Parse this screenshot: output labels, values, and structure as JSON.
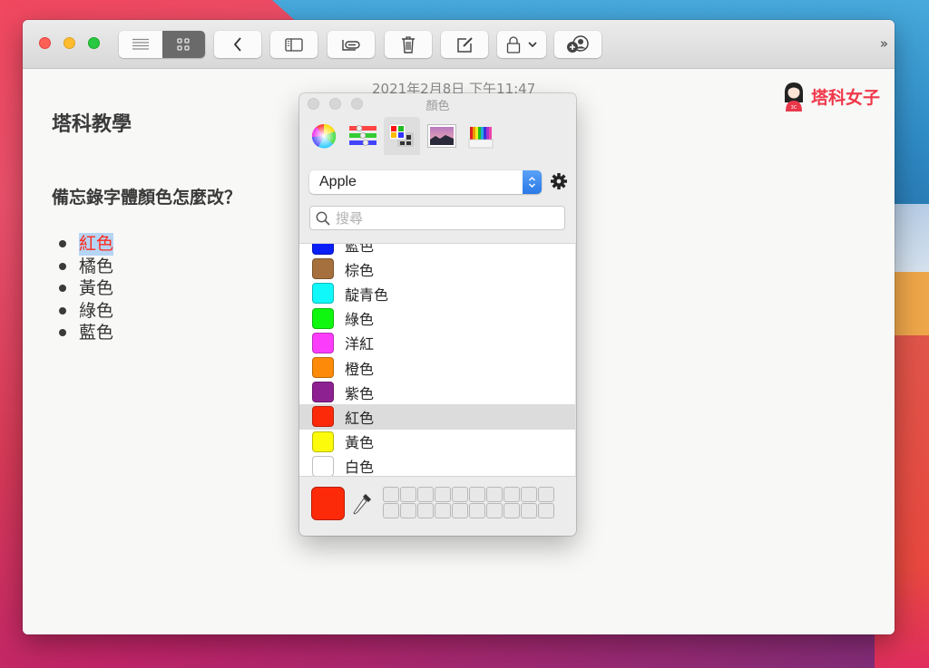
{
  "window": {
    "toolbar": {
      "buttons": [
        {
          "name": "list-view",
          "icon": "list-icon"
        },
        {
          "name": "gallery-view",
          "icon": "grid-icon",
          "active": true
        },
        {
          "name": "back",
          "icon": "chevron-left-icon"
        },
        {
          "name": "sidebar",
          "icon": "sidebar-icon"
        },
        {
          "name": "attachments",
          "icon": "paperclip-icon"
        },
        {
          "name": "delete",
          "icon": "trash-icon"
        },
        {
          "name": "compose",
          "icon": "compose-icon"
        },
        {
          "name": "lock",
          "icon": "lock-icon"
        },
        {
          "name": "add-people",
          "icon": "add-person-icon"
        }
      ],
      "more_label": "»"
    },
    "note": {
      "date": "2021年2月8日 下午11:47",
      "title": "塔科教學",
      "subtitle": "備忘錄字體顏色怎麼改？",
      "items": [
        {
          "text": "紅色",
          "selected": true,
          "color": "#ff2a1a"
        },
        {
          "text": "橘色"
        },
        {
          "text": "黃色"
        },
        {
          "text": "綠色"
        },
        {
          "text": "藍色"
        }
      ]
    },
    "brand": {
      "name": "塔科女子",
      "badge": "3C"
    }
  },
  "color_panel": {
    "title": "顏色",
    "modes": [
      {
        "name": "color-wheel",
        "icon": "color-wheel-icon"
      },
      {
        "name": "color-sliders",
        "icon": "sliders-icon"
      },
      {
        "name": "color-palettes",
        "icon": "palette-icon",
        "active": true
      },
      {
        "name": "image-palettes",
        "icon": "image-icon"
      },
      {
        "name": "pencils",
        "icon": "pencils-icon"
      }
    ],
    "palette_select": {
      "value": "Apple"
    },
    "search": {
      "placeholder": "搜尋"
    },
    "colors": [
      {
        "label": "藍色",
        "hex": "#0a1ef8"
      },
      {
        "label": "棕色",
        "hex": "#a5703d"
      },
      {
        "label": "靛青色",
        "hex": "#11f8fb"
      },
      {
        "label": "綠色",
        "hex": "#10f70f"
      },
      {
        "label": "洋紅",
        "hex": "#fb3dfb"
      },
      {
        "label": "橙色",
        "hex": "#fd8a08"
      },
      {
        "label": "紫色",
        "hex": "#8e2191"
      },
      {
        "label": "紅色",
        "hex": "#fd2a0a",
        "selected": true
      },
      {
        "label": "黃色",
        "hex": "#fbfb0b"
      },
      {
        "label": "白色",
        "hex": "#ffffff"
      }
    ],
    "current_color": "#fd2a0a",
    "saved_swatch_count": 20
  }
}
